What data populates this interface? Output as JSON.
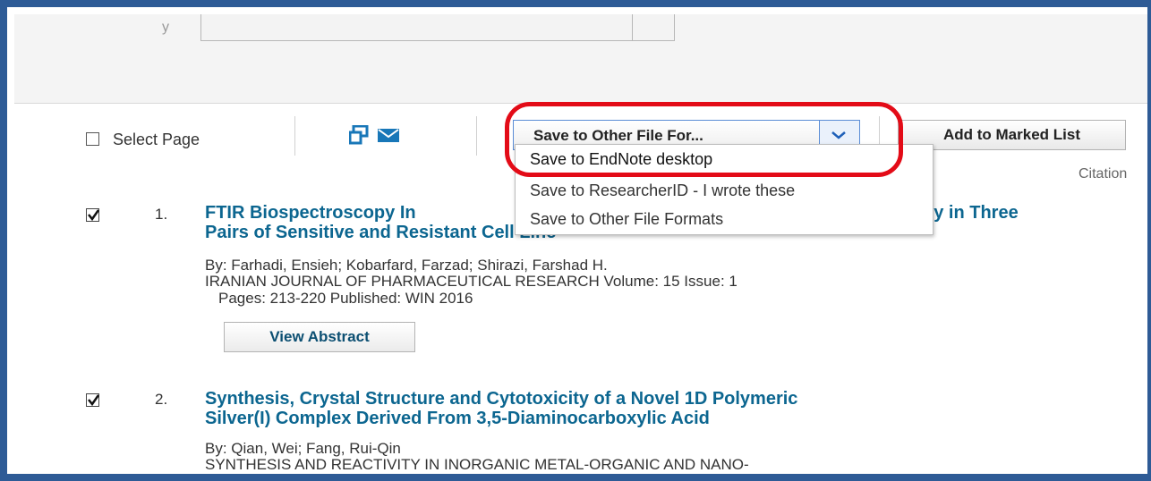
{
  "toolbar": {
    "select_page_label": "Select Page",
    "save_dropdown_label": "Save to Other File For...",
    "add_marked_label": "Add to Marked List"
  },
  "dropdown": {
    "items": [
      "Save to EndNote desktop",
      "Save to ResearcherID - I wrote these",
      "Save to Other File Formats"
    ]
  },
  "citation_label": "Citation",
  "records": [
    {
      "number": "1.",
      "title_line1": "FTIR Biospectroscopy In",
      "title_line1_end": "ity in Three",
      "title_line2": "Pairs of Sensitive and Resistant Cell Line",
      "authors": "By: Farhadi, Ensieh; Kobarfard, Farzad; Shirazi, Farshad H.",
      "journal": "IRANIAN JOURNAL OF PHARMACEUTICAL RESEARCH  Volume: 15   Issue: 1",
      "pages": "Pages: 213-220   Published: WIN 2016",
      "view_abstract": "View Abstract",
      "checked": true
    },
    {
      "number": "2.",
      "title_line1": "Synthesis, Crystal Structure and Cytotoxicity of a Novel 1D Polymeric",
      "title_line2": "Silver(I) Complex Derived From 3,5-Diaminocarboxylic Acid",
      "authors": "By: Qian, Wei; Fang, Rui-Qin",
      "journal": "SYNTHESIS AND REACTIVITY IN INORGANIC METAL-ORGANIC AND NANO-",
      "checked": true
    }
  ],
  "colors": {
    "frame": "#2e5b96",
    "title_link": "#0c6690",
    "highlight_oval": "#e30b17",
    "dropdown_border": "#5b8dd6"
  },
  "icons": [
    "print-icon",
    "email-icon",
    "chevron-down-icon",
    "checkmark-icon"
  ]
}
